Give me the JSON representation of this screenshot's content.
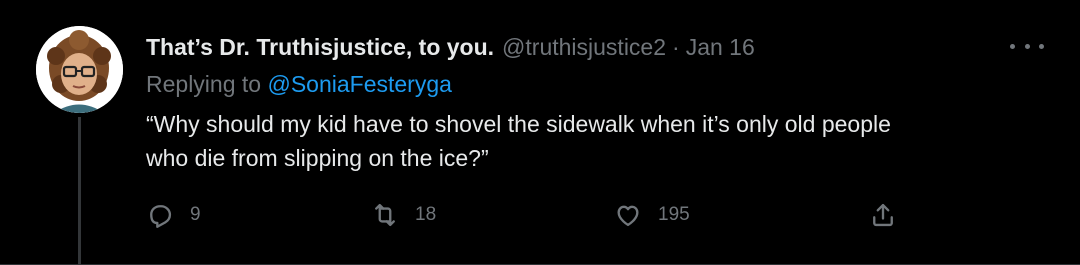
{
  "tweet": {
    "display_name": "That’s Dr. Truthisjustice, to you.",
    "handle": "@truthisjustice2",
    "separator": "·",
    "date": "Jan 16",
    "replying_prefix": "Replying to ",
    "replying_to": "@SoniaFesteryga",
    "text_line1": "“Why should my kid have to shovel the sidewalk when it’s only old people",
    "text_line2": "who die from slipping on the ice?”"
  },
  "actions": {
    "reply_count": "9",
    "retweet_count": "18",
    "like_count": "195"
  },
  "colors": {
    "background": "#000000",
    "text": "#e7e9ea",
    "muted": "#71767b",
    "link": "#1d9bf0"
  },
  "icons": [
    "more-horizontal-icon",
    "reply-icon",
    "retweet-icon",
    "like-icon",
    "share-icon"
  ]
}
